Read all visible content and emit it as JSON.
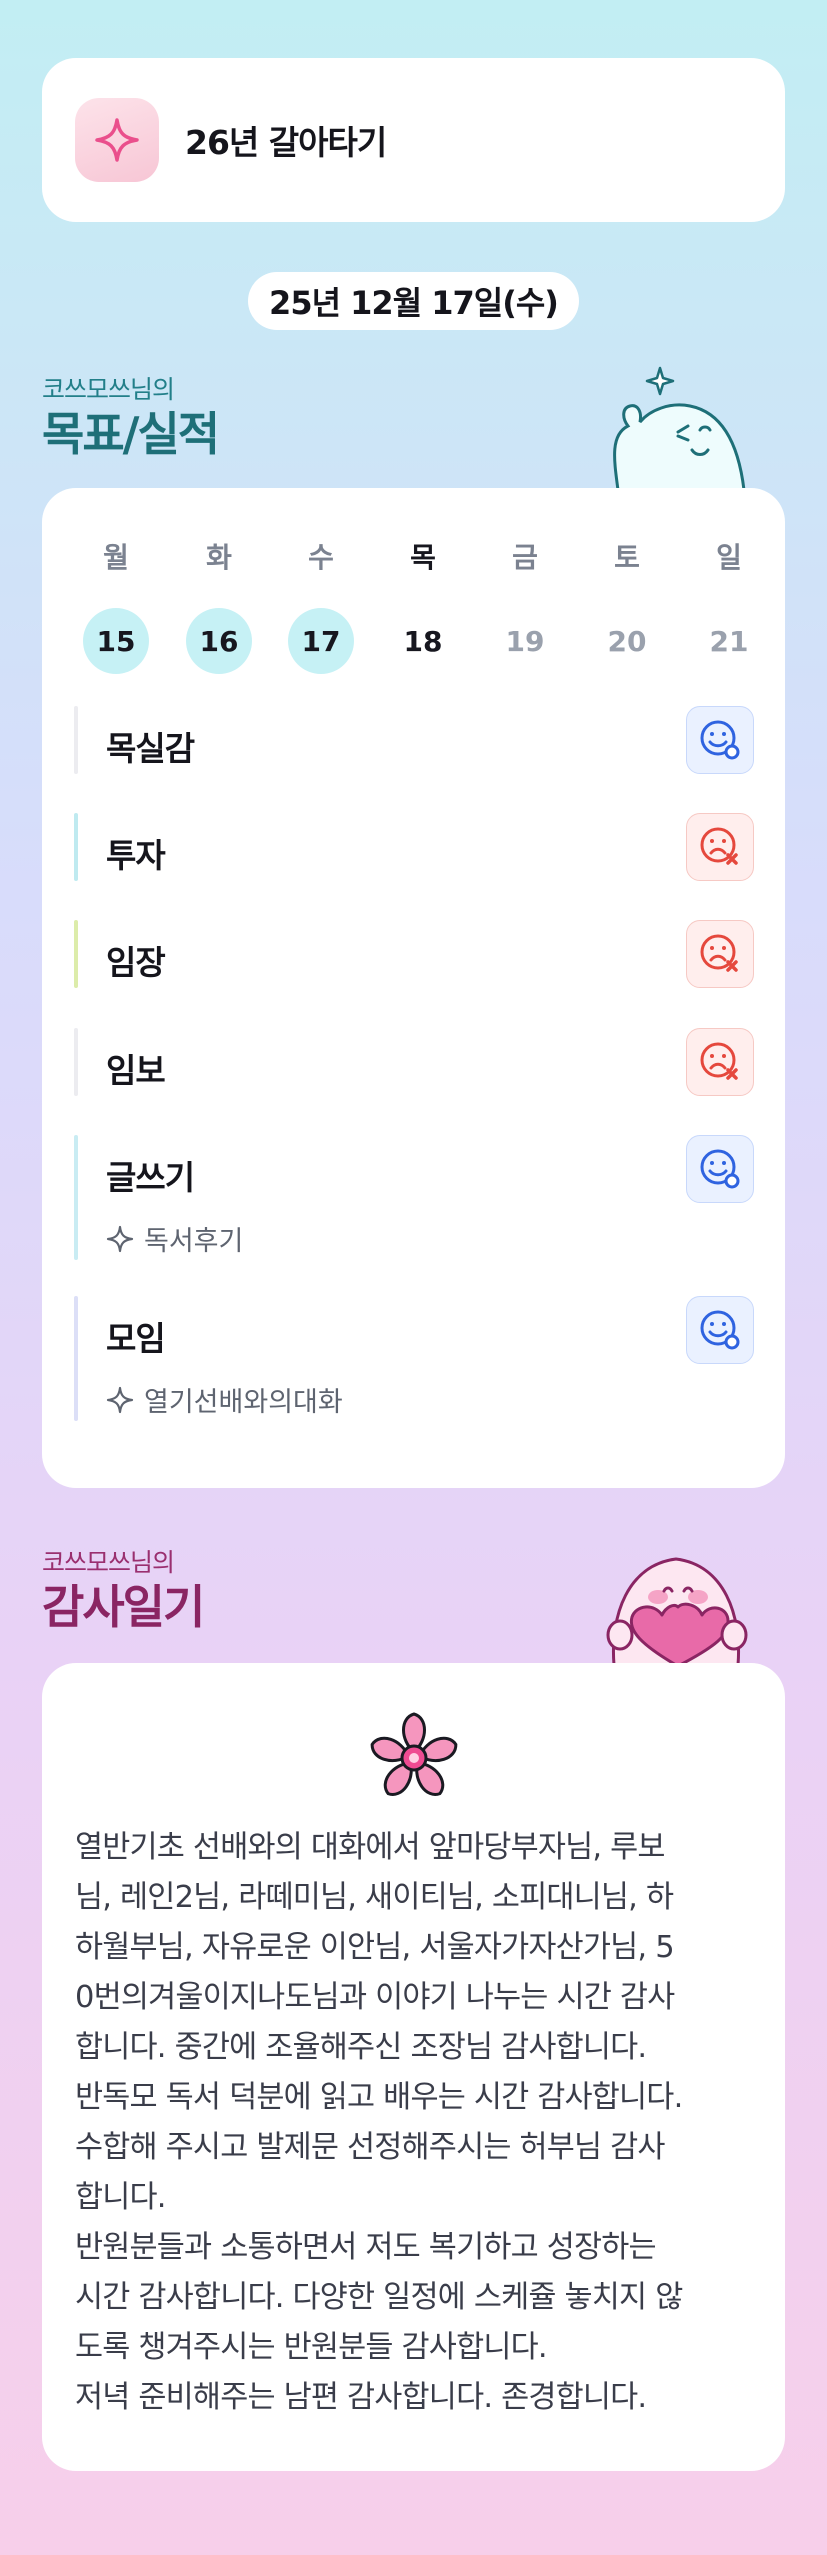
{
  "app": {
    "title": "26년 갈아타기",
    "icon": "sparkle-icon"
  },
  "date": "25년 12월 17일(수)",
  "goals_section": {
    "owner": "코쓰모쓰님의",
    "title": "목표/실적"
  },
  "week": [
    {
      "day": "월",
      "date": "15",
      "state": "done"
    },
    {
      "day": "화",
      "date": "16",
      "state": "done"
    },
    {
      "day": "수",
      "date": "17",
      "state": "done"
    },
    {
      "day": "목",
      "date": "18",
      "state": "today"
    },
    {
      "day": "금",
      "date": "19",
      "state": "future"
    },
    {
      "day": "토",
      "date": "20",
      "state": "future"
    },
    {
      "day": "일",
      "date": "21",
      "state": "future"
    }
  ],
  "goals": [
    {
      "label": "목실감",
      "status": "success",
      "bar_color": "#ececf0",
      "sub": ""
    },
    {
      "label": "투자",
      "status": "fail",
      "bar_color": "#bfeaf0",
      "sub": ""
    },
    {
      "label": "임장",
      "status": "fail",
      "bar_color": "#dcecaa",
      "sub": ""
    },
    {
      "label": "임보",
      "status": "fail",
      "bar_color": "#ececf0",
      "sub": ""
    },
    {
      "label": "글쓰기",
      "status": "success",
      "bar_color": "#c9ecf3",
      "sub": "독서후기"
    },
    {
      "label": "모임",
      "status": "success",
      "bar_color": "#dcdff7",
      "sub": "열기선배와의대화"
    }
  ],
  "gratitude_section": {
    "owner": "코쓰모쓰님의",
    "title": "감사일기"
  },
  "gratitude_lines": [
    "열반기초 선배와의 대화에서 앞마당부자님, 루보",
    "님, 레인2님, 라떼미님, 새이티님, 소피대니님, 하",
    "하월부님, 자유로운 이안님, 서울자가자산가님, 5",
    "0번의겨울이지나도님과 이야기 나누는 시간 감사",
    "합니다. 중간에 조율해주신 조장님 감사합니다.",
    "반독모 독서 덕분에 읽고 배우는 시간 감사합니다.",
    "수합해 주시고 발제문 선정해주시는 허부님 감사",
    "합니다.",
    "반원분들과 소통하면서 저도 복기하고 성장하는",
    "시간 감사합니다. 다양한 일정에 스케쥴 놓치지 않",
    "도록 챙겨주시는 반원분들 감사합니다.",
    "저녁 준비해주는 남편 감사합니다. 존경합니다."
  ],
  "colors": {
    "success": "#2f63e0",
    "fail": "#e5483d",
    "accent_teal": "#1e6f78",
    "accent_pink": "#8a2563"
  }
}
